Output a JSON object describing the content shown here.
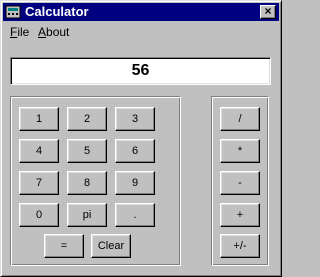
{
  "window": {
    "title": "Calculator",
    "close_label": "×"
  },
  "menu": {
    "file_mnemonic": "F",
    "file_rest": "ile",
    "about_mnemonic": "A",
    "about_rest": "bout"
  },
  "display": {
    "value": "56"
  },
  "keypad": {
    "row1": [
      "1",
      "2",
      "3"
    ],
    "row2": [
      "4",
      "5",
      "6"
    ],
    "row3": [
      "7",
      "8",
      "9"
    ],
    "row4": [
      "0",
      "pi",
      "."
    ],
    "equals": "=",
    "clear": "Clear"
  },
  "operators": [
    "/",
    "*",
    "-",
    "+",
    "+/-"
  ],
  "colors": {
    "titlebar": "#000080",
    "face": "#c0c0c0"
  },
  "icons": {
    "app": "calculator-icon"
  }
}
